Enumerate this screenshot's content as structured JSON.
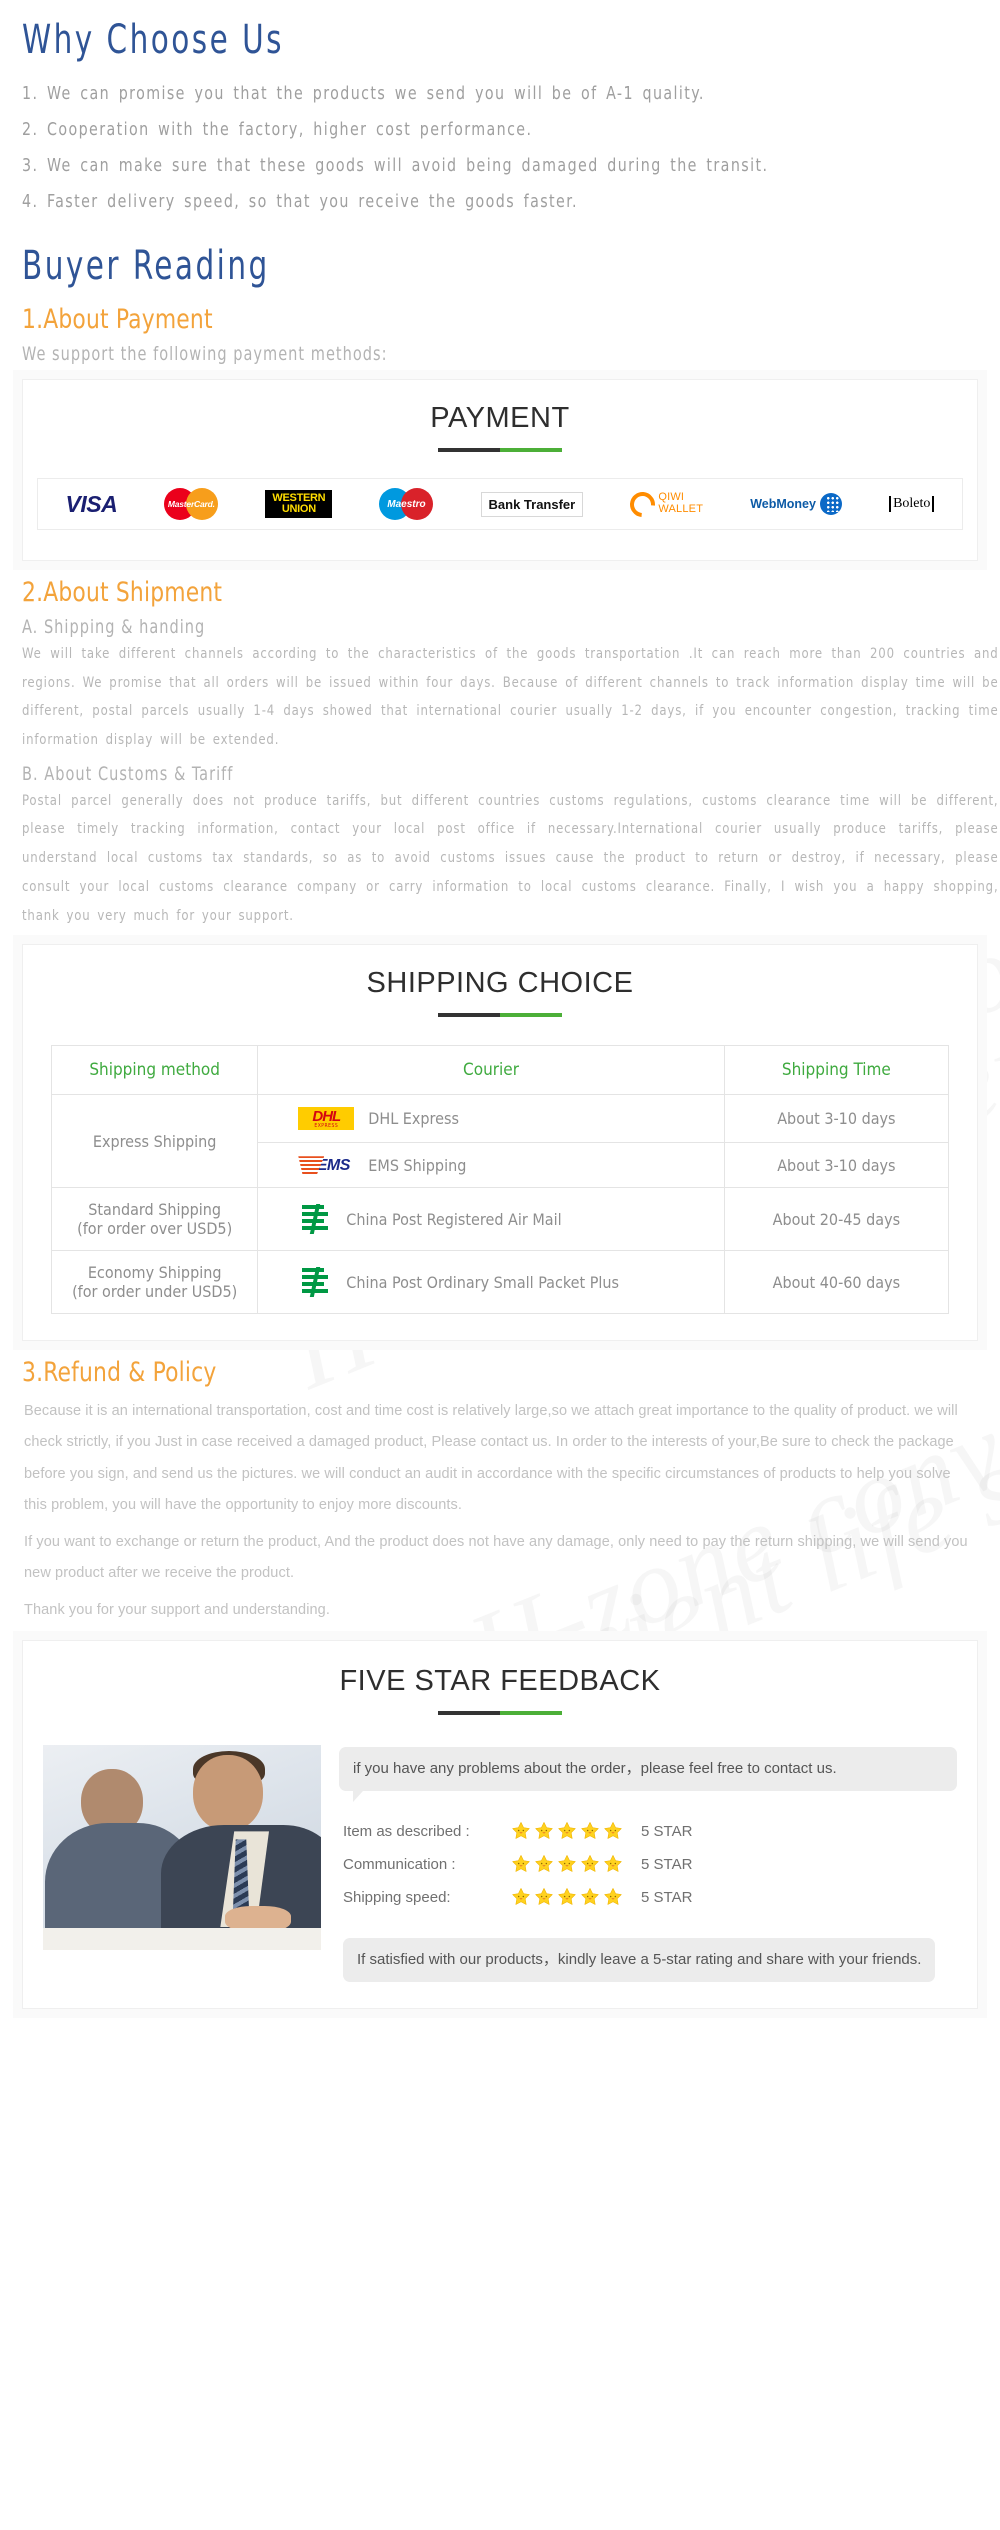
{
  "why_choose": {
    "title": "Why Choose Us",
    "items": [
      "1. We can promise you that the products we send you will be of A-1 quality.",
      "2. Cooperation with the factory, higher cost performance.",
      "3. We can make sure that these goods will avoid being damaged during the transit.",
      "4. Faster delivery speed, so that you receive the goods faster."
    ]
  },
  "buyer_reading": {
    "title": "Buyer  Reading"
  },
  "payment": {
    "heading": "1.About Payment",
    "intro": "We support the following payment methods:",
    "panel_title": "PAYMENT",
    "logos": [
      {
        "name": "visa-logo",
        "label": "VISA"
      },
      {
        "name": "mastercard-logo",
        "label": "MasterCard."
      },
      {
        "name": "western-union-logo",
        "label_line1": "WESTERN",
        "label_line2": "UNION"
      },
      {
        "name": "maestro-logo",
        "label": "Maestro"
      },
      {
        "name": "bank-transfer-logo",
        "label": "Bank Transfer"
      },
      {
        "name": "qiwi-wallet-logo",
        "label_line1": "QIWI",
        "label_line2": "WALLET"
      },
      {
        "name": "webmoney-logo",
        "label": "WebMoney"
      },
      {
        "name": "boleto-logo",
        "label": "Boleto"
      }
    ]
  },
  "shipment": {
    "heading": "2.About Shipment",
    "sub_a": "A. Shipping & handing",
    "para_a": "We will take different channels according to the characteristics of the goods transportation .It can reach more than 200 countries and regions. We promise that all orders will be issued within four days. Because of different channels to track information display time will be different, postal parcels usually 1-4 days showed that international courier usually 1-2 days, if you encounter congestion, tracking time information display will be extended.",
    "sub_b": "B. About Customs & Tariff",
    "para_b": "Postal parcel generally does not produce tariffs, but different countries customs regulations, customs clearance time will be different, please timely tracking information, contact your local post office if necessary.International courier usually produce tariffs, please understand local customs tax standards, so as to avoid customs issues cause the product to return or destroy, if necessary, please consult your local customs clearance company or carry information to local customs clearance. Finally, I wish you a happy shopping, thank you very much for your support."
  },
  "shipping_table": {
    "panel_title": "SHIPPING CHOICE",
    "headers": [
      "Shipping method",
      "Courier",
      "Shipping Time"
    ],
    "rows": [
      {
        "method": "Express Shipping",
        "method_rowspan": 2,
        "courier": "DHL Express",
        "courier_icon": "dhl-logo",
        "time": "About 3-10 days"
      },
      {
        "method": "",
        "method_rowspan": 0,
        "courier": "EMS Shipping",
        "courier_icon": "ems-logo",
        "time": "About 3-10 days"
      },
      {
        "method": "Standard Shipping",
        "method_line2": "(for order over USD5)",
        "method_rowspan": 1,
        "courier": "China Post Registered Air Mail",
        "courier_icon": "china-post-logo",
        "time": "About 20-45 days"
      },
      {
        "method": "Economy Shipping",
        "method_line2": "(for order under USD5)",
        "method_rowspan": 1,
        "courier": "China Post Ordinary Small Packet Plus",
        "courier_icon": "china-post-logo",
        "time": "About 40-60 days"
      }
    ]
  },
  "refund": {
    "heading": "3.Refund & Policy",
    "paragraphs": [
      "Because it is an international transportation, cost and time cost is relatively large,so we attach great importance to the quality of product. we will check strictly, if you Just in case received a damaged product, Please contact us. In order to the interests of your,Be sure to check the package before you sign, and send us the pictures. we will conduct an audit in accordance with the specific circumstances of products to help you solve this problem, you will have the opportunity to enjoy more discounts.",
      "If you want to exchange or return the product, And the product does not have any damage, only need to pay the return shipping, we will send you new product after we receive the product.",
      "Thank you for your support and understanding."
    ]
  },
  "feedback": {
    "panel_title": "FIVE STAR FEEDBACK",
    "bubble": "if you have any problems about the order，please feel free to contact us.",
    "ratings": [
      {
        "label": "Item as described :",
        "stars": 5,
        "value": "5 STAR"
      },
      {
        "label": "Communication :",
        "stars": 5,
        "value": "5 STAR"
      },
      {
        "label": "Shipping speed:",
        "stars": 5,
        "value": "5 STAR"
      }
    ],
    "final_note": "If satisfied with our products，kindly leave a 5-star rating and share with your friends."
  },
  "watermark": {
    "text": "H-zone convenient life store"
  },
  "colors": {
    "heading_blue": "#2f5496",
    "heading_orange": "#f3a33b",
    "table_header_green": "#3faa3f",
    "rule_green": "#4caf38",
    "rule_dark": "#333333",
    "body_grey": "#b7b7b7"
  }
}
